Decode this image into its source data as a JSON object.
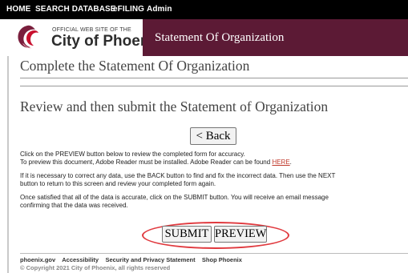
{
  "topnav": {
    "home": "HOME",
    "search": "SEARCH DATABASE",
    "efiling": "eFILING",
    "admin": "Admin"
  },
  "banner": {
    "logo_small": "OFFICIAL WEB SITE OF THE",
    "logo_big": "City of Phoenix",
    "logo_icon": "phoenix-bird-icon",
    "title": "Statement Of Organization"
  },
  "main": {
    "heading": "Complete the Statement Of Organization",
    "subheading": "Review and then submit the Statement of Organization",
    "back_label": "< Back",
    "para1_line1": "Click on the PREVIEW button below to review the completed form for accuracy.",
    "para1_line2": "To preview this document, Adobe Reader must be installed. Adobe Reader can be found",
    "para1_link": "HERE",
    "para1_end": ".",
    "para2_line1": "If it is necessary to correct any data, use the BACK button to find and fix the incorrect data. Then use the NEXT",
    "para2_line2": "button to return to this screen and review your completed form again.",
    "para3_line1": "Once satisfied that all of the data is accurate, click on the SUBMIT button. You will receive an email message",
    "para3_line2": "confirming that the data was received.",
    "submit_label": "SUBMIT",
    "preview_label": "PREVIEW"
  },
  "footer": {
    "links": [
      "phoenix.gov",
      "Accessibility",
      "Security and Privacy Statement",
      "Shop Phoenix"
    ],
    "copyright": "© Copyright 2021 City of Phoenix, all rights reserved"
  },
  "colors": {
    "banner_accent": "#5c1a35",
    "logo_red": "#c8102e",
    "logo_maroon": "#7a1f3d",
    "highlight_oval": "#e0393e"
  }
}
